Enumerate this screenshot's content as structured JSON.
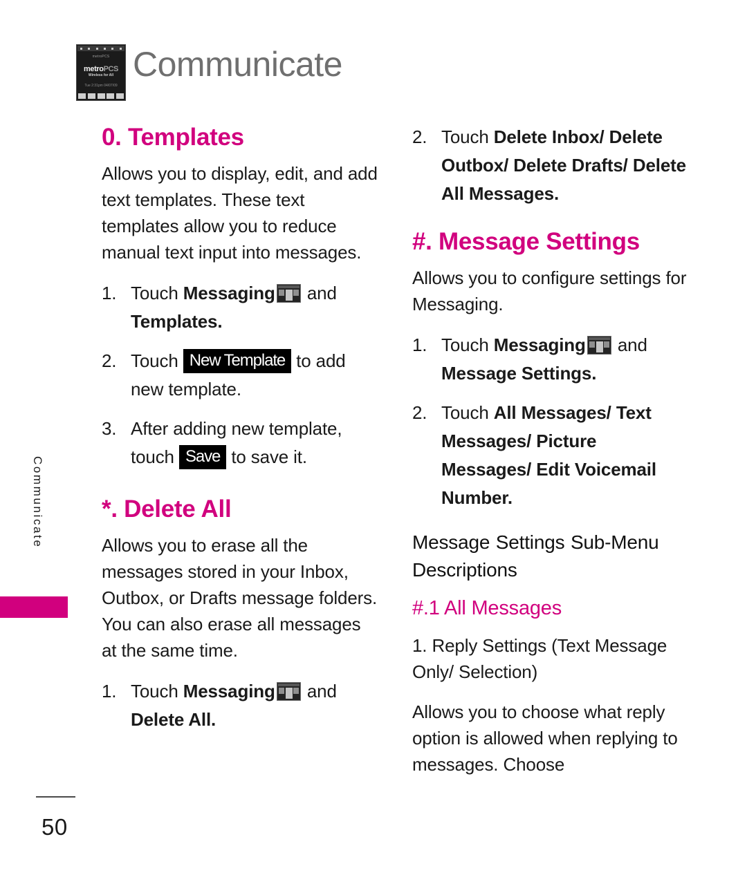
{
  "page": {
    "title": "Communicate",
    "number": "50",
    "side_tab_label": "Communicate",
    "accent_color": "#d1007e",
    "header_icon": "phone-screen-thumbnail"
  },
  "header_thumbnail": {
    "carrier": "metroPCS",
    "logo_main": "metro",
    "logo_suffix": "PCS",
    "tagline": "Wireless for All",
    "date": "Tue 2:31pm 04/07/09"
  },
  "left_column": {
    "sections": [
      {
        "id": "templates",
        "heading": "0. Templates",
        "intro": "Allows you to display, edit, and add text templates. These text templates allow you to reduce manual text input into messages.",
        "steps": [
          {
            "num": "1.",
            "parts": [
              {
                "type": "text",
                "value": "Touch "
              },
              {
                "type": "bold",
                "value": "Messaging"
              },
              {
                "type": "icon",
                "value": "messaging-menu-icon"
              },
              {
                "type": "text",
                "value": " and "
              },
              {
                "type": "bold",
                "value": "Templates"
              },
              {
                "type": "text",
                "value": "."
              }
            ]
          },
          {
            "num": "2.",
            "parts": [
              {
                "type": "text",
                "value": "Touch "
              },
              {
                "type": "chip",
                "value": "New Template"
              },
              {
                "type": "text",
                "value": " to add new template."
              }
            ]
          },
          {
            "num": "3.",
            "parts": [
              {
                "type": "text",
                "value": "After adding new template, touch "
              },
              {
                "type": "chip",
                "value": "Save"
              },
              {
                "type": "text",
                "value": " to save it."
              }
            ]
          }
        ]
      },
      {
        "id": "delete-all",
        "heading": "*. Delete All",
        "intro": "Allows you to erase all the messages stored in your Inbox, Outbox, or Drafts message folders. You can also erase all messages at the same time.",
        "steps": [
          {
            "num": "1.",
            "parts": [
              {
                "type": "text",
                "value": "Touch "
              },
              {
                "type": "bold",
                "value": "Messaging"
              },
              {
                "type": "icon",
                "value": "messaging-menu-icon"
              },
              {
                "type": "text",
                "value": " and "
              },
              {
                "type": "bold",
                "value": "Delete All"
              },
              {
                "type": "text",
                "value": "."
              }
            ]
          }
        ]
      }
    ]
  },
  "right_column": {
    "continued_step": {
      "num": "2.",
      "parts": [
        {
          "type": "text",
          "value": "Touch "
        },
        {
          "type": "bold",
          "value": "Delete Inbox/ Delete Outbox/ Delete Drafts/ Delete All Messages"
        },
        {
          "type": "text",
          "value": "."
        }
      ]
    },
    "sections": [
      {
        "id": "message-settings",
        "heading": "#. Message Settings",
        "intro": "Allows you to configure settings for Messaging.",
        "steps": [
          {
            "num": "1.",
            "parts": [
              {
                "type": "text",
                "value": "Touch "
              },
              {
                "type": "bold",
                "value": "Messaging"
              },
              {
                "type": "icon",
                "value": "messaging-menu-icon"
              },
              {
                "type": "text",
                "value": " and "
              },
              {
                "type": "bold",
                "value": "Message Settings"
              },
              {
                "type": "text",
                "value": "."
              }
            ]
          },
          {
            "num": "2.",
            "parts": [
              {
                "type": "text",
                "value": "Touch "
              },
              {
                "type": "bold",
                "value": "All Messages/ Text Messages/ Picture Messages/ Edit Voicemail Number"
              },
              {
                "type": "text",
                "value": "."
              }
            ]
          }
        ]
      }
    ],
    "submenu_heading": "Message Settings Sub-Menu Descriptions",
    "submenu_sections": [
      {
        "id": "all-messages",
        "heading": "#.1 All Messages",
        "item_heading": "1. Reply Settings (Text Message Only/ Selection)",
        "item_body": "Allows you to choose what reply option is allowed when replying to messages. Choose"
      }
    ]
  }
}
